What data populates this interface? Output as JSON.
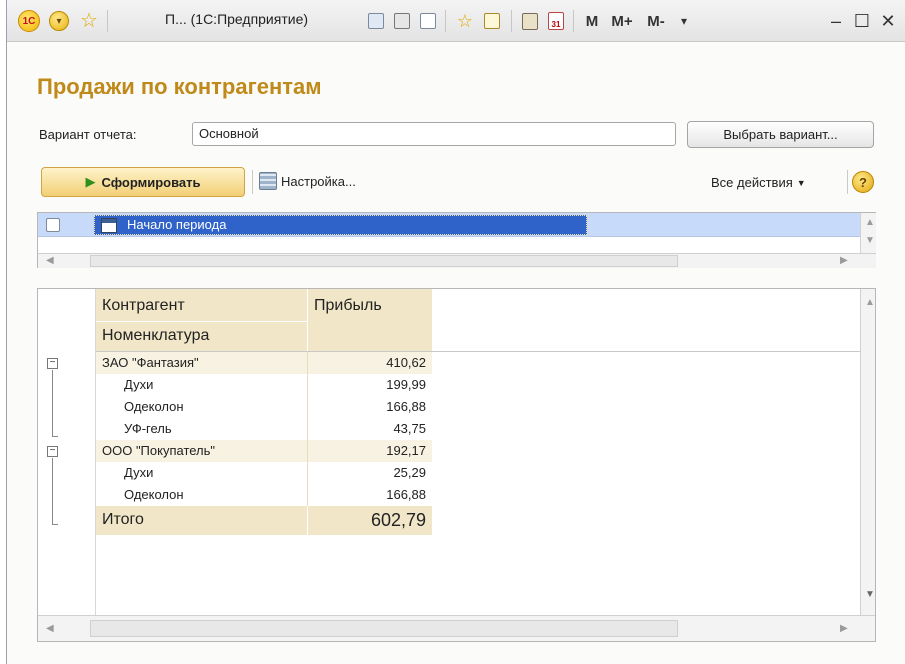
{
  "titlebar": {
    "title": "П... (1С:Предприятие)",
    "m_label": "M",
    "mplus_label": "M+",
    "mminus_label": "M-",
    "minimize": "–",
    "maximize": "☐",
    "close": "✕"
  },
  "page": {
    "title": "Продажи по контрагентам"
  },
  "variant": {
    "label": "Вариант отчета:",
    "value": "Основной",
    "choose_button": "Выбрать вариант..."
  },
  "toolbar": {
    "generate_button": "Сформировать",
    "settings_button": "Настройка...",
    "all_actions": "Все действия",
    "help": "?"
  },
  "settings_list": {
    "items": [
      {
        "label": "Начало периода",
        "checked": false
      }
    ]
  },
  "report": {
    "headers": {
      "col1_line1": "Контрагент",
      "col1_line2": "Номенклатура",
      "col2": "Прибыль"
    },
    "groups": [
      {
        "name": "ЗАО \"Фантазия\"",
        "value": "410,62",
        "items": [
          {
            "name": "Духи",
            "value": "199,99"
          },
          {
            "name": "Одеколон",
            "value": "166,88"
          },
          {
            "name": "УФ-гель",
            "value": "43,75"
          }
        ]
      },
      {
        "name": "ООО \"Покупатель\"",
        "value": "192,17",
        "items": [
          {
            "name": "Духи",
            "value": "25,29"
          },
          {
            "name": "Одеколон",
            "value": "166,88"
          }
        ]
      }
    ],
    "total": {
      "name": "Итого",
      "value": "602,79"
    }
  },
  "colors": {
    "title": "#c08a1a",
    "header_bg": "#f1e7c8",
    "selection": "#2f63c9"
  }
}
